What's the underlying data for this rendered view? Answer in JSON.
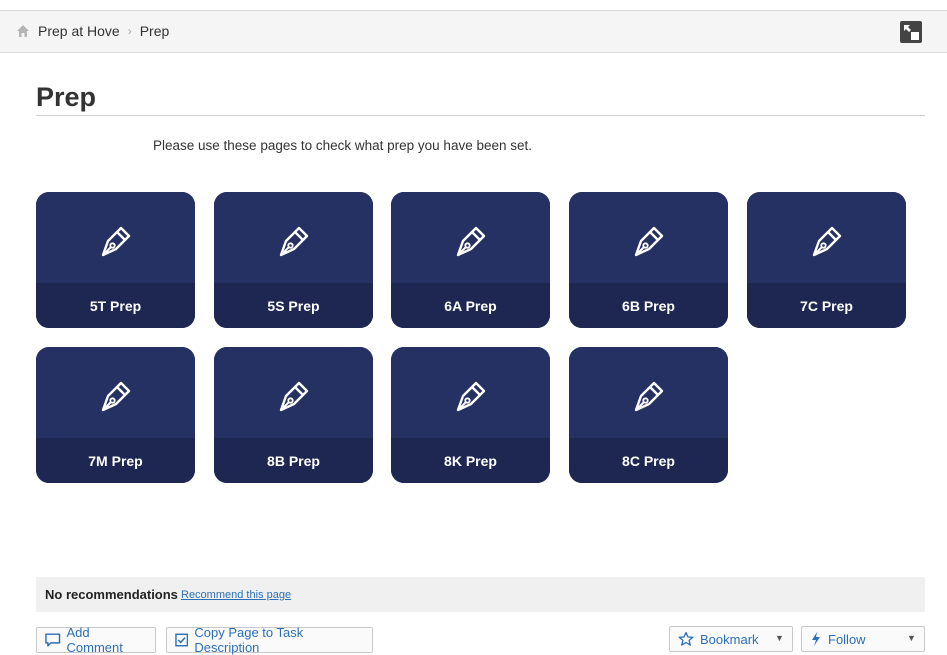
{
  "breadcrumb": {
    "items": [
      "Prep at Hove",
      "Prep"
    ]
  },
  "page": {
    "title": "Prep",
    "intro": "Please use these pages to check what prep you have been set."
  },
  "tiles": [
    {
      "label": "5T Prep"
    },
    {
      "label": "5S Prep"
    },
    {
      "label": "6A Prep"
    },
    {
      "label": "6B Prep"
    },
    {
      "label": "7C Prep"
    },
    {
      "label": "7M Prep"
    },
    {
      "label": "8B Prep"
    },
    {
      "label": "8K Prep"
    },
    {
      "label": "8C Prep"
    }
  ],
  "recommendations": {
    "label": "No recommendations",
    "link": "Recommend this page"
  },
  "actions": {
    "add_comment": "Add Comment",
    "copy_page": "Copy Page to Task Description",
    "bookmark": "Bookmark",
    "follow": "Follow"
  },
  "colors": {
    "tile_top": "#253063",
    "tile_bottom": "#1e2752",
    "link": "#2c6fb7"
  },
  "icons": {
    "tile": "fountain-pen-icon",
    "home": "home-icon",
    "expand": "expand-icon"
  }
}
